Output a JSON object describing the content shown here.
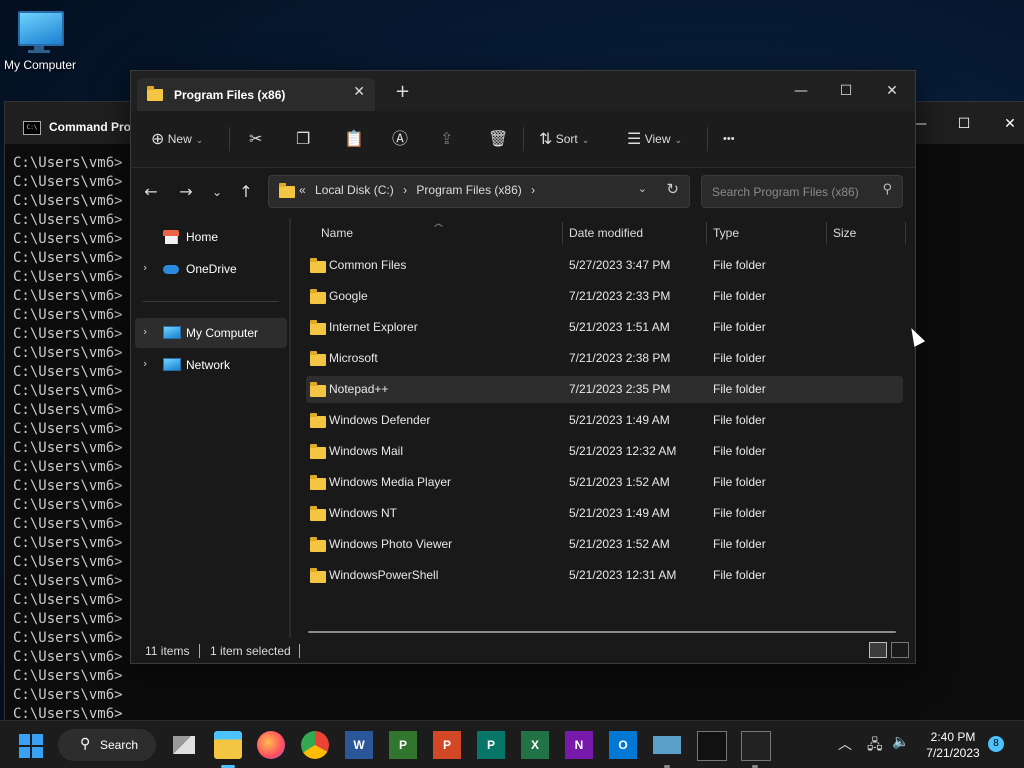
{
  "desktop": {
    "icons": [
      {
        "label": "My Computer",
        "icon": "monitor-icon"
      }
    ]
  },
  "cmd": {
    "title": "Command Pro",
    "prompt_text": "C:\\Users\\vm6>",
    "line_count": 30
  },
  "explorer": {
    "tab_title": "Program Files (x86)",
    "toolbar": {
      "new_label": "New",
      "sort_label": "Sort",
      "view_label": "View",
      "more_label": "•••"
    },
    "address": {
      "overflow": "«",
      "crumbs": [
        "Local Disk (C:)",
        "Program Files (x86)"
      ],
      "separator": "›"
    },
    "search": {
      "placeholder": "Search Program Files (x86)"
    },
    "nav": {
      "items": [
        {
          "label": "Home",
          "icon": "home-icon"
        },
        {
          "label": "OneDrive",
          "icon": "cloud-icon"
        },
        {
          "label": "My Computer",
          "icon": "computer-icon"
        },
        {
          "label": "Network",
          "icon": "network-icon"
        }
      ]
    },
    "columns": [
      "Name",
      "Date modified",
      "Type",
      "Size"
    ],
    "rows": [
      {
        "name": "Common Files",
        "date": "5/27/2023 3:47 PM",
        "type": "File folder",
        "size": ""
      },
      {
        "name": "Google",
        "date": "7/21/2023 2:33 PM",
        "type": "File folder",
        "size": ""
      },
      {
        "name": "Internet Explorer",
        "date": "5/21/2023 1:51 AM",
        "type": "File folder",
        "size": ""
      },
      {
        "name": "Microsoft",
        "date": "7/21/2023 2:38 PM",
        "type": "File folder",
        "size": ""
      },
      {
        "name": "Notepad++",
        "date": "7/21/2023 2:35 PM",
        "type": "File folder",
        "size": ""
      },
      {
        "name": "Windows Defender",
        "date": "5/21/2023 1:49 AM",
        "type": "File folder",
        "size": ""
      },
      {
        "name": "Windows Mail",
        "date": "5/21/2023 12:32 AM",
        "type": "File folder",
        "size": ""
      },
      {
        "name": "Windows Media Player",
        "date": "5/21/2023 1:52 AM",
        "type": "File folder",
        "size": ""
      },
      {
        "name": "Windows NT",
        "date": "5/21/2023 1:49 AM",
        "type": "File folder",
        "size": ""
      },
      {
        "name": "Windows Photo Viewer",
        "date": "5/21/2023 1:52 AM",
        "type": "File folder",
        "size": ""
      },
      {
        "name": "WindowsPowerShell",
        "date": "5/21/2023 12:31 AM",
        "type": "File folder",
        "size": ""
      }
    ],
    "selected_row": "Notepad++",
    "status": {
      "count": "11 items",
      "selection": "1 item selected"
    }
  },
  "taskbar": {
    "search_label": "Search",
    "apps": [
      {
        "name": "task-view",
        "color": "#d0d0d0"
      },
      {
        "name": "file-explorer",
        "color": "#f4c542"
      },
      {
        "name": "firefox",
        "color": "#ff7139"
      },
      {
        "name": "chrome",
        "color": "#4285f4"
      },
      {
        "name": "word",
        "color": "#2b579a",
        "glyph": "W"
      },
      {
        "name": "project",
        "color": "#31752f",
        "glyph": "P"
      },
      {
        "name": "powerpoint",
        "color": "#d24726",
        "glyph": "P"
      },
      {
        "name": "publisher",
        "color": "#077568",
        "glyph": "P"
      },
      {
        "name": "excel",
        "color": "#217346",
        "glyph": "X"
      },
      {
        "name": "onenote",
        "color": "#7719aa",
        "glyph": "N"
      },
      {
        "name": "outlook",
        "color": "#0078d4",
        "glyph": "O"
      },
      {
        "name": "rdp",
        "color": "#5aa0c8"
      },
      {
        "name": "cmd",
        "color": "#111111"
      },
      {
        "name": "terminal",
        "color": "#222222"
      }
    ],
    "time": "2:40 PM",
    "date": "7/21/2023",
    "notification_count": "8"
  },
  "colors": {
    "accent": "#4cc2ff",
    "folder": "#f4c542",
    "window_bg": "#191919"
  }
}
